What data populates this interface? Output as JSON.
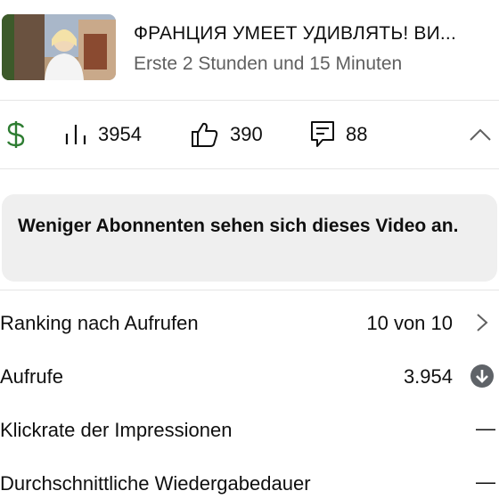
{
  "video": {
    "title": "ФРАНЦИЯ УМЕЕТ УДИВЛЯТЬ! ВИ...",
    "subtitle": "Erste 2 Stunden und 15 Minuten"
  },
  "stats": {
    "revenue_icon": "dollar-icon",
    "views": "3954",
    "likes": "390",
    "comments": "88"
  },
  "notice": {
    "text": "Weniger Abonnenten sehen sich dieses Video an."
  },
  "metrics": [
    {
      "label": "Ranking nach Aufrufen",
      "value": "10 von 10",
      "icon": "chevron-right-icon"
    },
    {
      "label": "Aufrufe",
      "value": "3.954",
      "icon": "arrow-down-circle-icon"
    },
    {
      "label": "Klickrate der Impressionen",
      "value": "—"
    },
    {
      "label": "Durchschnittliche Wiedergabedauer",
      "value": "—"
    }
  ],
  "colors": {
    "dollar_green": "#2e7d32",
    "divider": "#e5e5e5",
    "notice_bg": "#efefef",
    "secondary_text": "#606060",
    "down_circle": "#5f6368"
  }
}
